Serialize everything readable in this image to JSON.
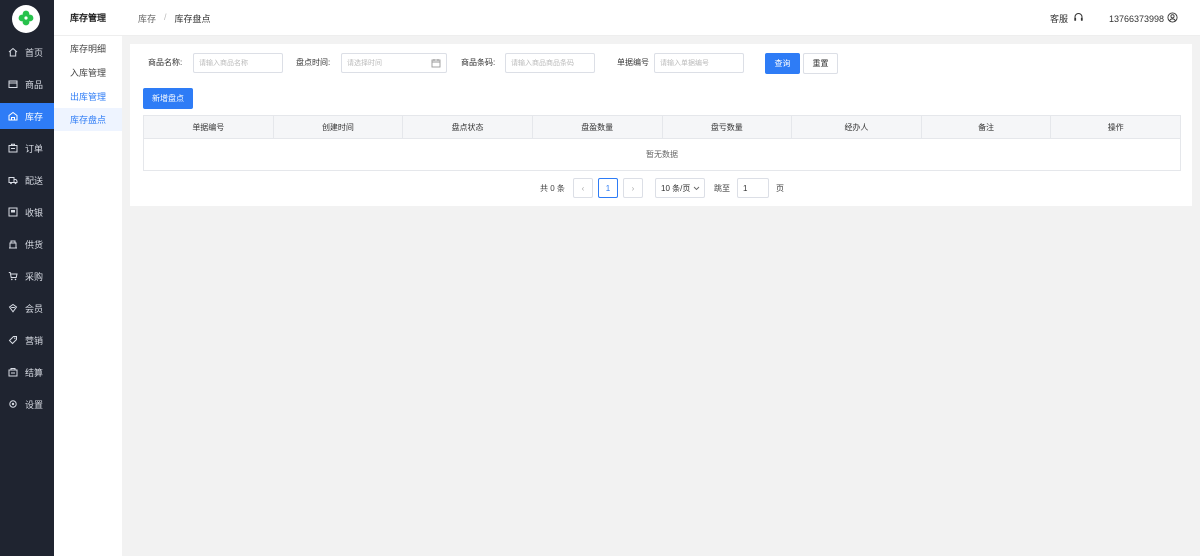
{
  "colors": {
    "primary": "#2e7cf6",
    "rail_bg": "#1f2430",
    "logo_green": "#27c24c"
  },
  "rail": {
    "logo_icon": "clover-logo-icon",
    "items": [
      {
        "label": "首页",
        "icon": "home-icon"
      },
      {
        "label": "商品",
        "icon": "goods-icon"
      },
      {
        "label": "库存",
        "icon": "warehouse-icon",
        "active": true
      },
      {
        "label": "订单",
        "icon": "order-icon"
      },
      {
        "label": "配送",
        "icon": "truck-icon"
      },
      {
        "label": "收银",
        "icon": "cashier-icon"
      },
      {
        "label": "供货",
        "icon": "supply-icon"
      },
      {
        "label": "采购",
        "icon": "cart-icon"
      },
      {
        "label": "会员",
        "icon": "member-icon"
      },
      {
        "label": "营销",
        "icon": "tag-icon"
      },
      {
        "label": "结算",
        "icon": "settle-icon"
      },
      {
        "label": "设置",
        "icon": "gear-icon"
      }
    ]
  },
  "submenu": {
    "title": "库存管理",
    "items": [
      "库存明细",
      "入库管理",
      "出库管理",
      "库存盘点"
    ]
  },
  "header": {
    "breadcrumb": [
      "库存",
      "库存盘点"
    ],
    "breadcrumb_sep": "/",
    "service_label": "客服",
    "user_phone": "13766373998"
  },
  "filters": {
    "product_name": {
      "label": "商品名称:",
      "placeholder": "请输入商品名称"
    },
    "check_time": {
      "label": "盘点时间:",
      "placeholder": "请选择时间"
    },
    "barcode": {
      "label": "商品条码:",
      "placeholder": "请输入商品商品条码"
    },
    "doc_no": {
      "label": "单据编号",
      "placeholder": "请输入单据编号"
    },
    "search_button": "查询",
    "reset_button": "重置"
  },
  "add_button": "新增盘点",
  "table": {
    "columns": [
      "单据编号",
      "创建时间",
      "盘点状态",
      "盘盈数量",
      "盘亏数量",
      "经办人",
      "备注",
      "操作"
    ],
    "empty_text": "暂无数据"
  },
  "pagination": {
    "total_text": "共 0 条",
    "prev": "‹",
    "current_page": "1",
    "next": "›",
    "page_size": "10 条/页",
    "jump_label": "跳至",
    "jump_value": "1",
    "page_unit": "页"
  }
}
